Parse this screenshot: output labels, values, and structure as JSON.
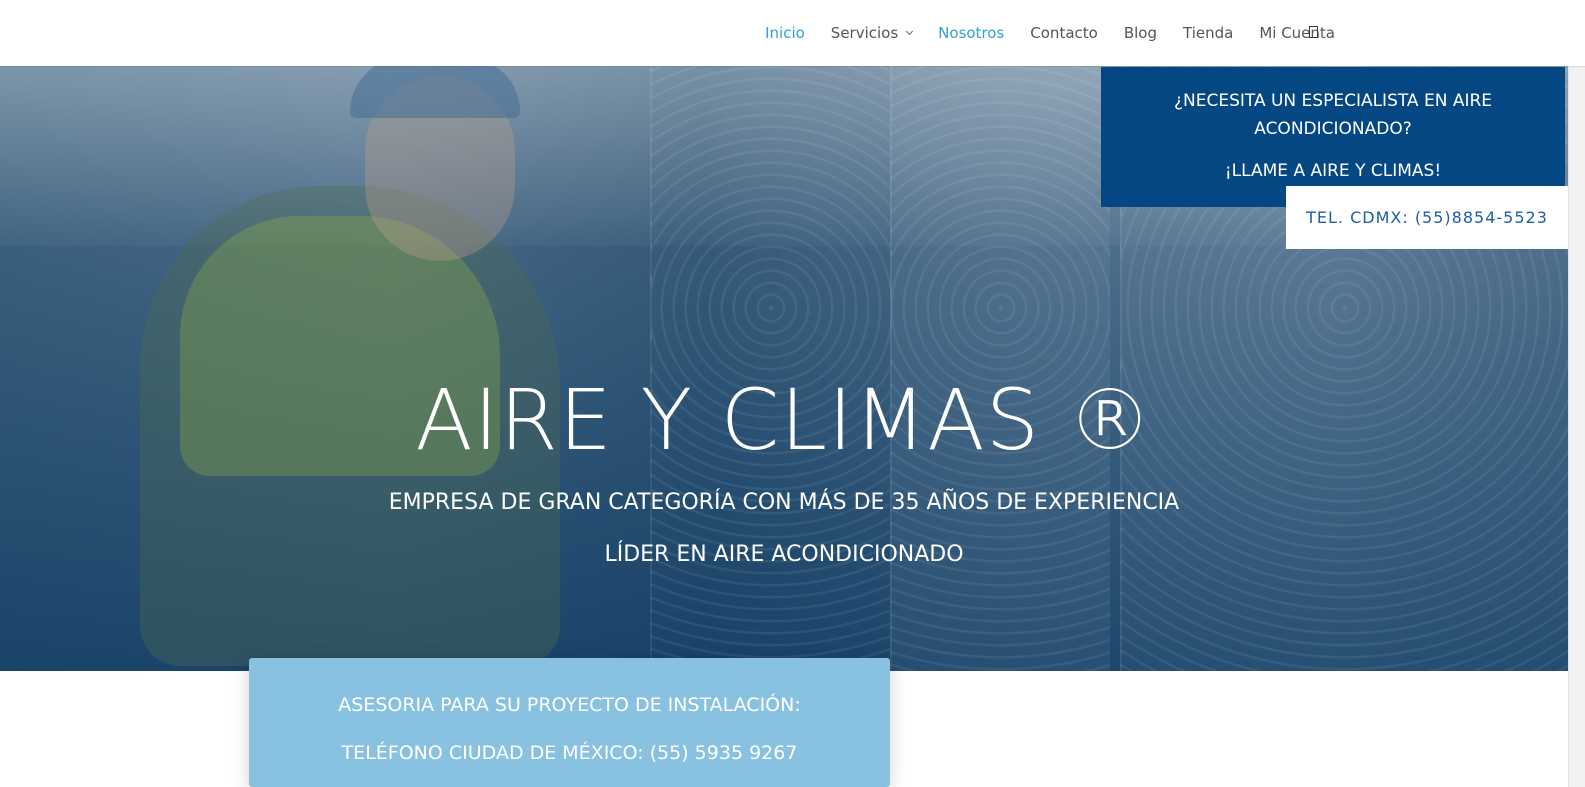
{
  "nav": {
    "items": [
      {
        "label": "Inicio",
        "active": true,
        "dropdown": false
      },
      {
        "label": "Servicios",
        "active": false,
        "dropdown": true
      },
      {
        "label": "Nosotros",
        "active": true,
        "dropdown": false
      },
      {
        "label": "Contacto",
        "active": false,
        "dropdown": false
      },
      {
        "label": "Blog",
        "active": false,
        "dropdown": false
      },
      {
        "label": "Tienda",
        "active": false,
        "dropdown": false
      },
      {
        "label": "Mi Cuenta",
        "active": false,
        "dropdown": false
      }
    ],
    "search_icon": "search-icon",
    "active_color": "#2ea3d6"
  },
  "callout": {
    "question": "¿NECESITA UN ESPECIALISTA EN AIRE ACONDICIONADO?",
    "cta": "¡LLAME A AIRE Y CLIMAS!",
    "phone_button": "TEL. CDMX: (55)8854-5523",
    "background": "#054783"
  },
  "hero": {
    "title": "AIRE Y CLIMAS ®",
    "subtitle_1": "EMPRESA DE GRAN CATEGORÍA CON MÁS DE 35 AÑOS DE EXPERIENCIA",
    "subtitle_2": "LÍDER EN AIRE ACONDICIONADO"
  },
  "info_box": {
    "line_1": "ASESORIA PARA SU PROYECTO DE INSTALACIÓN:",
    "line_2": "TELÉFONO CIUDAD DE MÉXICO: (55) 5935 9267",
    "background": "#89c2e0"
  }
}
